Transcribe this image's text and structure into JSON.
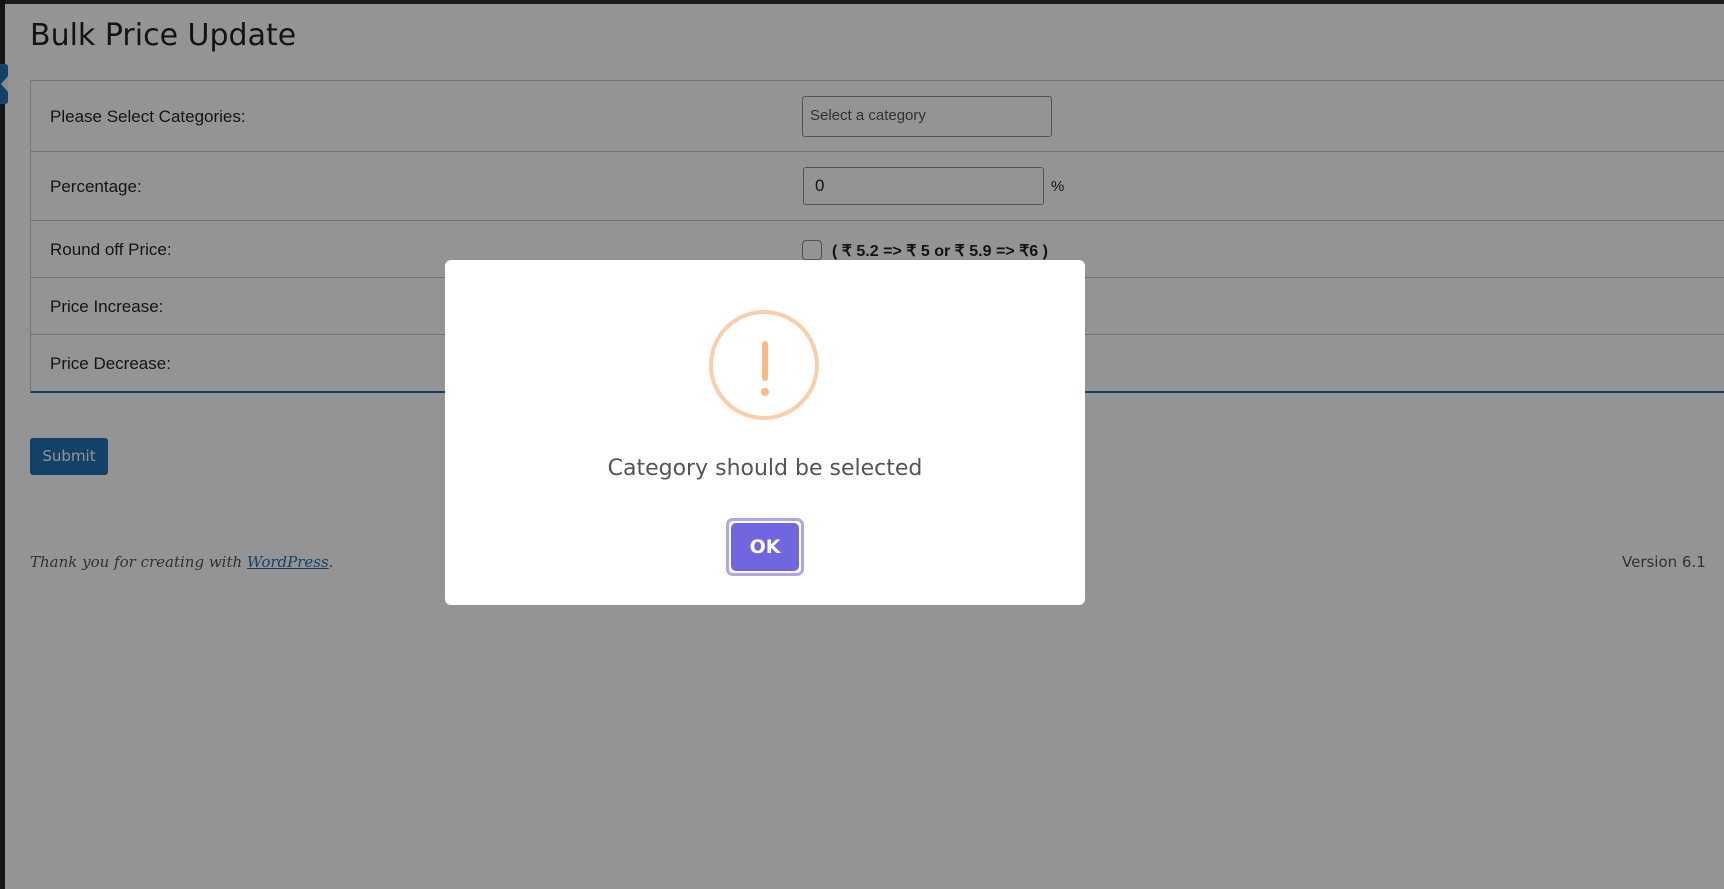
{
  "page": {
    "title": "Bulk Price Update"
  },
  "form": {
    "rows": [
      {
        "label": "Please Select Categories:"
      },
      {
        "label": "Percentage:"
      },
      {
        "label": "Round off Price:"
      },
      {
        "label": "Price Increase:"
      },
      {
        "label": "Price Decrease:"
      }
    ],
    "category_placeholder": "Select a category",
    "percentage_value": "0",
    "percentage_unit": "%",
    "round_off_checked": false,
    "round_off_note": "( ₹ 5.2 => ₹ 5 or ₹ 5.9 => ₹6 )",
    "submit_label": "Submit"
  },
  "footer": {
    "thanks_prefix": "Thank you for creating with ",
    "thanks_link": "WordPress",
    "thanks_suffix": ".",
    "version": "Version 6.1"
  },
  "modal": {
    "icon": "warning-icon",
    "message": "Category should be selected",
    "ok_label": "OK"
  },
  "colors": {
    "accent": "#2271b1",
    "modal_button": "#7066e0",
    "warning": "#f8bb86"
  }
}
